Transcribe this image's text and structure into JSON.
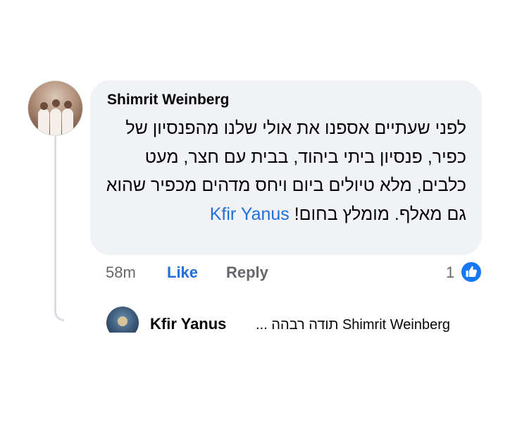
{
  "comment": {
    "author": "Shimrit Weinberg",
    "text": "לפני שעתיים אספנו את אולי שלנו מהפנסיון של כפיר, פנסיון ביתי ביהוד, בבית עם חצר, מעט כלבים, מלא טיולים ביום ויחס מדהים מכפיר שהוא גם מאלף. מומלץ בחום!",
    "mention": "Kfir Yanus",
    "time": "58m",
    "like_label": "Like",
    "reply_label": "Reply",
    "reaction_count": "1",
    "reaction_icon": "thumbs-up-icon",
    "accent_color": "#216fdb"
  },
  "reply": {
    "author": "Kfir Yanus",
    "text": "Shimrit Weinberg תודה רבהה ..."
  }
}
